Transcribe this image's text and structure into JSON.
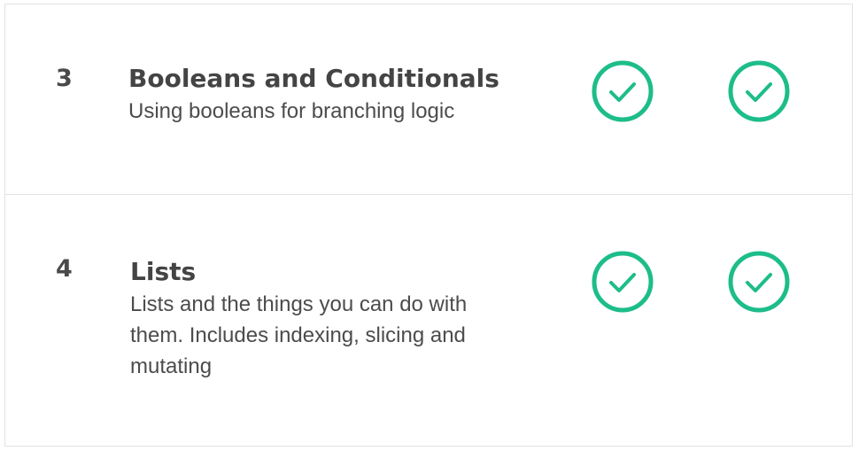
{
  "lessons": [
    {
      "number": "3",
      "title": "Booleans and Conditionals",
      "description": "Using booleans for branching logic",
      "status_icons": [
        "check-circle-icon",
        "check-circle-icon"
      ]
    },
    {
      "number": "4",
      "title": "Lists",
      "description": "Lists and the things you can do with them. Includes indexing, slicing and mutating",
      "status_icons": [
        "check-circle-icon",
        "check-circle-icon"
      ]
    }
  ],
  "colors": {
    "check": "#1dbd8a",
    "divider": "#e2e2e2"
  }
}
